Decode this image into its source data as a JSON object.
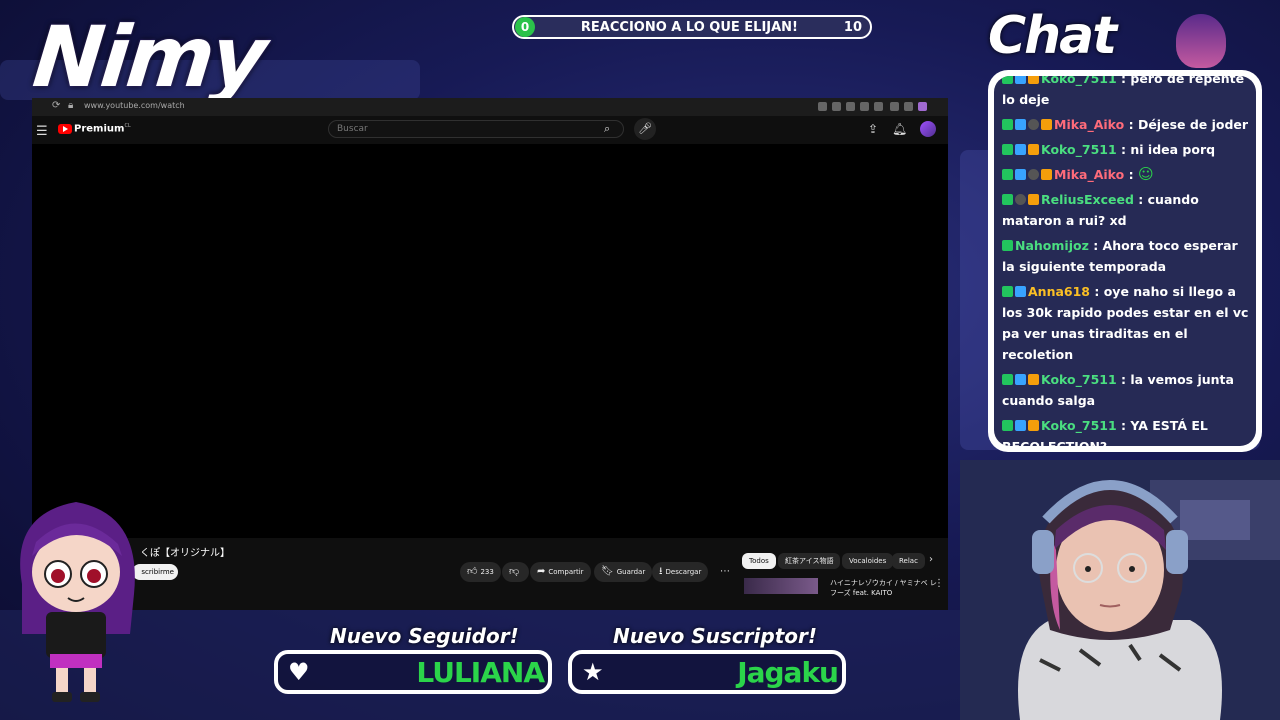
{
  "streamer": {
    "name": "Nimy"
  },
  "goal": {
    "current": "0",
    "title": "REACCIONO A LO QUE ELIJAN!",
    "target": "10"
  },
  "browser": {
    "url": "www.youtube.com/watch",
    "brand": "Premium",
    "brand_sup": "CL",
    "search_placeholder": "Buscar"
  },
  "video": {
    "title_fragment": "くぽ【オリジナル】",
    "subscribe_label": "scribirme",
    "likes": "233",
    "actions": {
      "share": "Compartir",
      "save": "Guardar",
      "download": "Descargar"
    }
  },
  "chips": [
    "Todos",
    "紅茶アイス物語",
    "Vocaloides",
    "Relac"
  ],
  "recommendation": {
    "title": "ハイニナレゾウカイ / ヤミナベ レフーズ feat. KAITO"
  },
  "chat": {
    "heading": "Chat",
    "messages": [
      {
        "user": "Koko_7511",
        "text": "pero de repente lo deje",
        "color": "#4ade80",
        "badges": [
          "k",
          "b",
          "g"
        ]
      },
      {
        "user": "Mika_Aiko",
        "text": "Déjese de joder",
        "color": "#ff6b7a",
        "badges": [
          "k",
          "b",
          "r",
          "g"
        ]
      },
      {
        "user": "Koko_7511",
        "text": "ni idea porq",
        "color": "#4ade80",
        "badges": [
          "k",
          "b",
          "g"
        ]
      },
      {
        "user": "Mika_Aiko",
        "text": "",
        "color": "#ff6b7a",
        "badges": [
          "k",
          "b",
          "r",
          "g"
        ],
        "emote": true
      },
      {
        "user": "ReliusExceed",
        "text": "cuando mataron a rui? xd",
        "color": "#4ade80",
        "badges": [
          "k",
          "r",
          "g"
        ]
      },
      {
        "user": "Nahomijoz",
        "text": "Ahora toco esperar la siguiente temporada",
        "color": "#4ade80",
        "badges": [
          "k"
        ]
      },
      {
        "user": "Anna618",
        "text": "oye naho si llego a los 30k rapido podes estar en el vc pa ver unas tiraditas en el recoletion",
        "color": "#fbbf24",
        "badges": [
          "k",
          "b"
        ]
      },
      {
        "user": "Koko_7511",
        "text": "la vemos junta cuando salga",
        "color": "#4ade80",
        "badges": [
          "k",
          "b",
          "g"
        ]
      },
      {
        "user": "Koko_7511",
        "text": "YA ESTÁ EL RECOLECTION?",
        "color": "#4ade80",
        "badges": [
          "k",
          "b",
          "g"
        ]
      }
    ]
  },
  "alerts": {
    "follower": {
      "title": "Nuevo Seguidor!",
      "name": "LULIANA"
    },
    "subscriber": {
      "title": "Nuevo Suscriptor!",
      "name": "Jagaku"
    }
  }
}
